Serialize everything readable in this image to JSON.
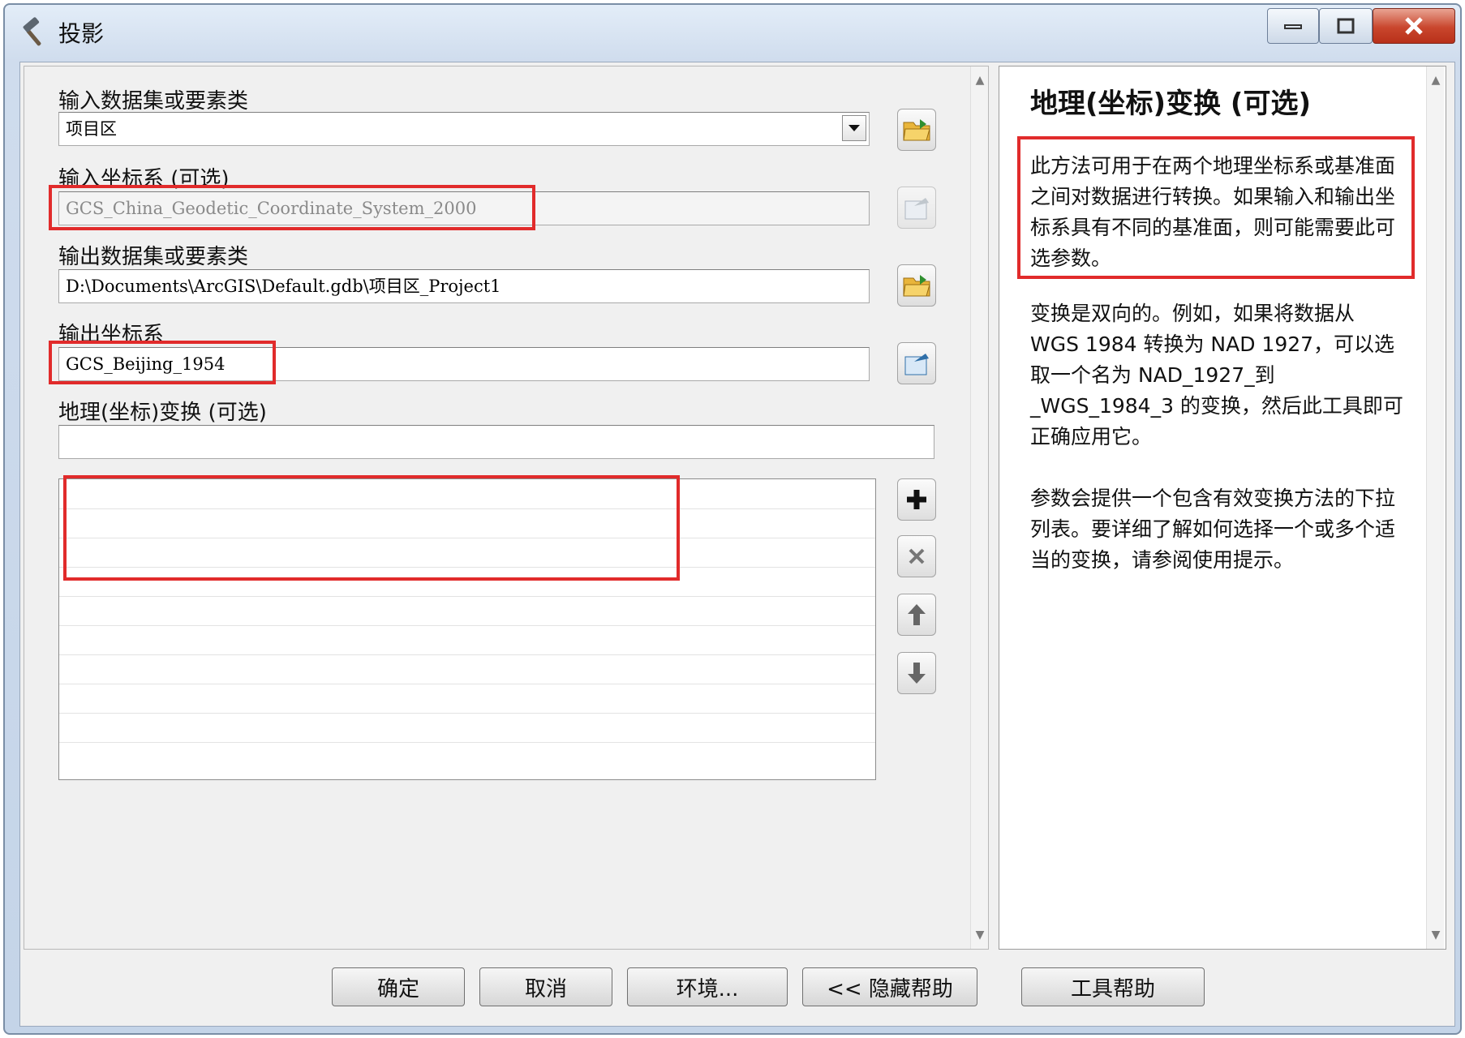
{
  "window": {
    "title": "投影"
  },
  "form": {
    "input_dataset_label": "输入数据集或要素类",
    "input_dataset_value": "项目区",
    "input_cs_label": "输入坐标系 (可选)",
    "input_cs_value": "GCS_China_Geodetic_Coordinate_System_2000",
    "output_dataset_label": "输出数据集或要素类",
    "output_dataset_value": "D:\\Documents\\ArcGIS\\Default.gdb\\项目区_Project1",
    "output_cs_label": "输出坐标系",
    "output_cs_value": "GCS_Beijing_1954",
    "geo_transform_label": "地理(坐标)变换 (可选)",
    "geo_transform_value": ""
  },
  "buttons": {
    "ok": "确定",
    "cancel": "取消",
    "environments": "环境...",
    "hide_help": "<< 隐藏帮助",
    "tool_help": "工具帮助"
  },
  "help": {
    "title": "地理(坐标)变换 (可选)",
    "para1": "此方法可用于在两个地理坐标系或基准面之间对数据进行转换。如果输入和输出坐标系具有不同的基准面，则可能需要此可选参数。",
    "para2": "变换是双向的。例如，如果将数据从 WGS 1984 转换为 NAD 1927，可以选取一个名为 NAD_1927_到_WGS_1984_3 的变换，然后此工具即可正确应用它。",
    "para3": "参数会提供一个包含有效变换方法的下拉列表。要详细了解如何选择一个或多个适当的变换，请参阅使用提示。"
  },
  "colors": {
    "highlight": "#e12b2b",
    "title_bar": "#cfdced",
    "close_button": "#c9462d"
  },
  "icons": {
    "title": "hammer-icon",
    "browse": "folder-open-icon",
    "cs_properties": "coordinate-system-icon",
    "add": "plus-icon",
    "remove": "x-icon",
    "up": "arrow-up-icon",
    "down": "arrow-down-icon"
  }
}
